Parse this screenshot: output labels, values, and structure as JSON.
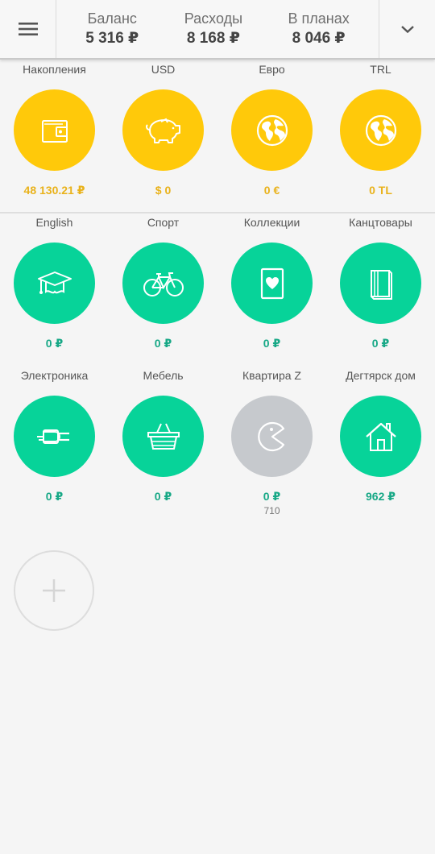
{
  "header": {
    "menu_icon": "hamburger-menu-icon",
    "expand_icon": "chevron-down-icon",
    "summary": [
      {
        "label": "Баланс",
        "value": "5 316 ₽"
      },
      {
        "label": "Расходы",
        "value": "8 168 ₽"
      },
      {
        "label": "В планах",
        "value": "8 046 ₽"
      }
    ]
  },
  "accounts": [
    {
      "title": "Накопления",
      "amount": "48 130.21 ₽",
      "icon": "wallet-icon",
      "color": "#ffc90a"
    },
    {
      "title": "USD",
      "amount": "$ 0",
      "icon": "piggy-bank-icon",
      "color": "#ffc90a"
    },
    {
      "title": "Евро",
      "amount": "0 €",
      "icon": "globe-icon",
      "color": "#ffc90a"
    },
    {
      "title": "TRL",
      "amount": "0 TL",
      "icon": "globe-icon",
      "color": "#ffc90a"
    }
  ],
  "categories": [
    {
      "title": "English",
      "amount": "0 ₽",
      "icon": "graduation-cap-icon",
      "color": "#07d399"
    },
    {
      "title": "Спорт",
      "amount": "0 ₽",
      "icon": "bicycle-icon",
      "color": "#07d399"
    },
    {
      "title": "Коллекции",
      "amount": "0 ₽",
      "icon": "playing-card-icon",
      "color": "#07d399"
    },
    {
      "title": "Канцтовары",
      "amount": "0 ₽",
      "icon": "books-icon",
      "color": "#07d399"
    },
    {
      "title": "Электроника",
      "amount": "0 ₽",
      "icon": "plug-icon",
      "color": "#07d399"
    },
    {
      "title": "Мебель",
      "amount": "0 ₽",
      "icon": "basket-icon",
      "color": "#07d399"
    },
    {
      "title": "Квартира Z",
      "amount": "0 ₽",
      "sub": "710",
      "icon": "pacman-icon",
      "color": "#c6c9cd"
    },
    {
      "title": "Дегтярск дом",
      "amount": "962 ₽",
      "icon": "house-icon",
      "color": "#07d399"
    }
  ],
  "add_button": {
    "icon": "plus-icon"
  }
}
